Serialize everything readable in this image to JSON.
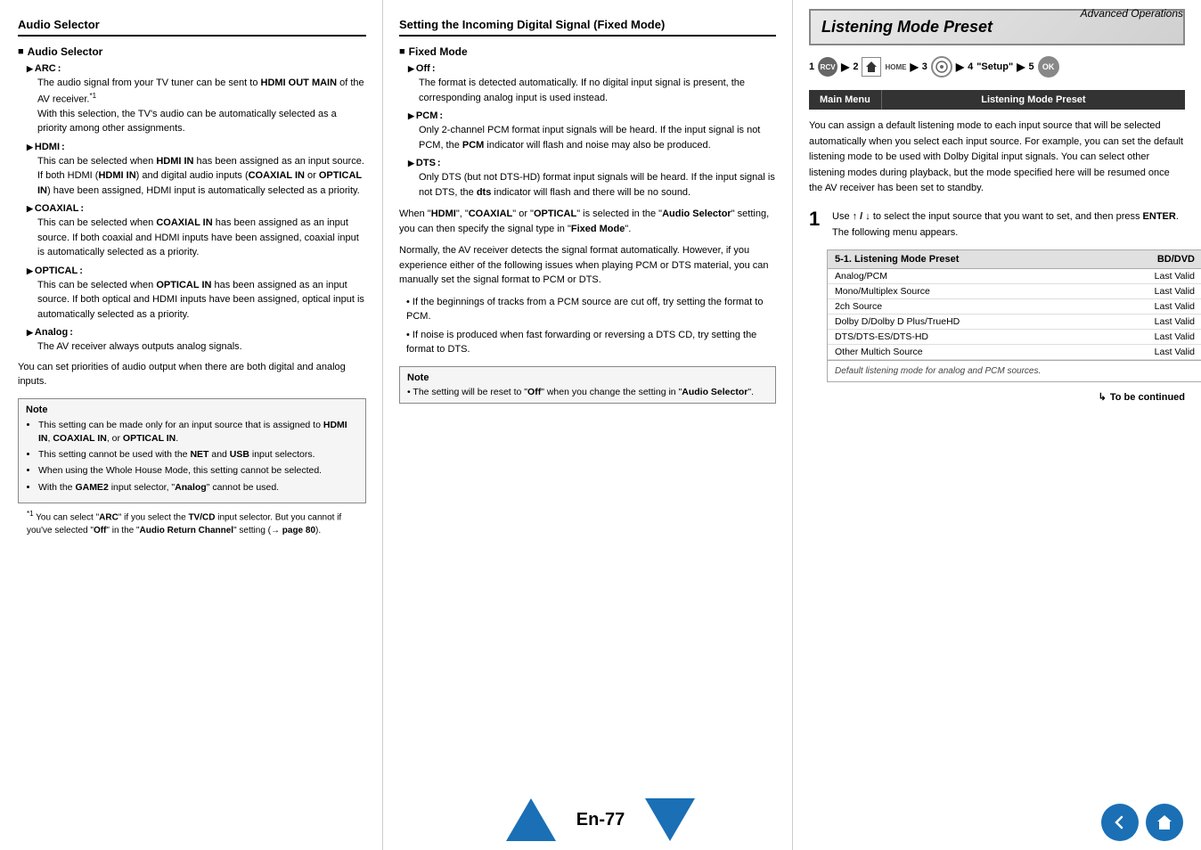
{
  "header": {
    "title": "Advanced Operations"
  },
  "left_column": {
    "section_title": "Audio Selector",
    "subsection_title": "Audio Selector",
    "items": [
      {
        "name": "ARC",
        "body": "The audio signal from your TV tuner can be sent to HDMI OUT MAIN of the AV receiver.*1 With this selection, the TV's audio can be automatically selected as a priority among other assignments."
      },
      {
        "name": "HDMI",
        "body": "This can be selected when HDMI IN has been assigned as an input source. If both HDMI (HDMI IN) and digital audio inputs (COAXIAL IN or OPTICAL IN) have been assigned, HDMI input is automatically selected as a priority."
      },
      {
        "name": "COAXIAL",
        "body": "This can be selected when COAXIAL IN has been assigned as an input source. If both coaxial and HDMI inputs have been assigned, coaxial input is automatically selected as a priority."
      },
      {
        "name": "OPTICAL",
        "body": "This can be selected when OPTICAL IN has been assigned as an input source. If both optical and HDMI inputs have been assigned, optical input is automatically selected as a priority."
      },
      {
        "name": "Analog",
        "body": "The AV receiver always outputs analog signals."
      }
    ],
    "after_items_text": "You can set priorities of audio output when there are both digital and analog inputs.",
    "note_title": "Note",
    "notes": [
      "This setting can be made only for an input source that is assigned to HDMI IN, COAXIAL IN, or OPTICAL IN.",
      "This setting cannot be used with the NET and USB input selectors.",
      "When using the Whole House Mode, this setting cannot be selected.",
      "With the GAME2 input selector, \"Analog\" cannot be used."
    ],
    "footnote_1": "*1  You can select \"ARC\" if you select the TV/CD input selector. But you cannot if you've selected \"Off\" in the \"Audio Return Channel\" setting (→ page 80)."
  },
  "mid_column": {
    "section_title": "Setting the Incoming Digital Signal (Fixed Mode)",
    "subsection_title": "Fixed Mode",
    "items": [
      {
        "name": "Off",
        "body": "The format is detected automatically. If no digital input signal is present, the corresponding analog input is used instead."
      },
      {
        "name": "PCM",
        "body": "Only 2-channel PCM format input signals will be heard. If the input signal is not PCM, the PCM indicator will flash and noise may also be produced."
      },
      {
        "name": "DTS",
        "body": "Only DTS (but not DTS-HD) format input signals will be heard. If the input signal is not DTS, the dts indicator will flash and there will be no sound."
      }
    ],
    "after_items_text": "When \"HDMI\", \"COAXIAL\" or \"OPTICAL\" is selected in the \"Audio Selector\" setting, you can then specify the signal type in \"Fixed Mode\".",
    "normally_text": "Normally, the AV receiver detects the signal format automatically. However, if you experience either of the following issues when playing PCM or DTS material, you can manually set the signal format to PCM or DTS.",
    "bullet_1": "If the beginnings of tracks from a PCM source are cut off, try setting the format to PCM.",
    "bullet_2": "If noise is produced when fast forwarding or reversing a DTS CD, try setting the format to DTS.",
    "note_title": "Note",
    "note_text": "The setting will be reset to \"Off\" when you change the setting in \"Audio Selector\"."
  },
  "right_column": {
    "section_title": "Listening Mode Preset",
    "steps": [
      {
        "num": "1",
        "icon": "receiver-icon",
        "label": ""
      },
      {
        "arrow": "▶"
      },
      {
        "num": "2",
        "icon": "home-icon",
        "label": "HOME"
      },
      {
        "arrow": "▶"
      },
      {
        "num": "3",
        "icon": "selector-icon"
      },
      {
        "arrow": "▶"
      },
      {
        "num": "4",
        "label": "\"Setup\""
      },
      {
        "arrow": "▶"
      },
      {
        "num": "5",
        "icon": "ok-icon"
      }
    ],
    "menu_bar": {
      "left": "Main Menu",
      "right": "Listening Mode Preset"
    },
    "description": "You can assign a default listening mode to each input source that will be selected automatically when you select each input source. For example, you can set the default listening mode to be used with Dolby Digital input signals. You can select other listening modes during playback, but the mode specified here will be resumed once the AV receiver has been set to standby.",
    "step1": {
      "number": "1",
      "instruction": "Use  ↑ / ↓  to select the input source that you want to set, and then press ENTER.",
      "following": "The following menu appears."
    },
    "menu_table": {
      "header_left": "5-1. Listening Mode Preset",
      "header_right": "BD/DVD",
      "rows": [
        {
          "left": "Analog/PCM",
          "right": "Last Valid"
        },
        {
          "left": "Mono/Multiplex Source",
          "right": "Last Valid"
        },
        {
          "left": "2ch Source",
          "right": "Last Valid"
        },
        {
          "left": "Dolby D/Dolby D Plus/TrueHD",
          "right": "Last Valid"
        },
        {
          "left": "DTS/DTS-ES/DTS-HD",
          "right": "Last Valid"
        },
        {
          "left": "Other Multich Source",
          "right": "Last Valid"
        }
      ],
      "footer": "Default listening mode for analog and PCM sources."
    },
    "to_be_continued": "To be continued"
  },
  "bottom": {
    "page_label": "En-77",
    "prev_icon": "prev-page-icon",
    "next_icon": "next-page-icon",
    "back_icon": "back-icon",
    "home_icon": "home-nav-icon"
  }
}
